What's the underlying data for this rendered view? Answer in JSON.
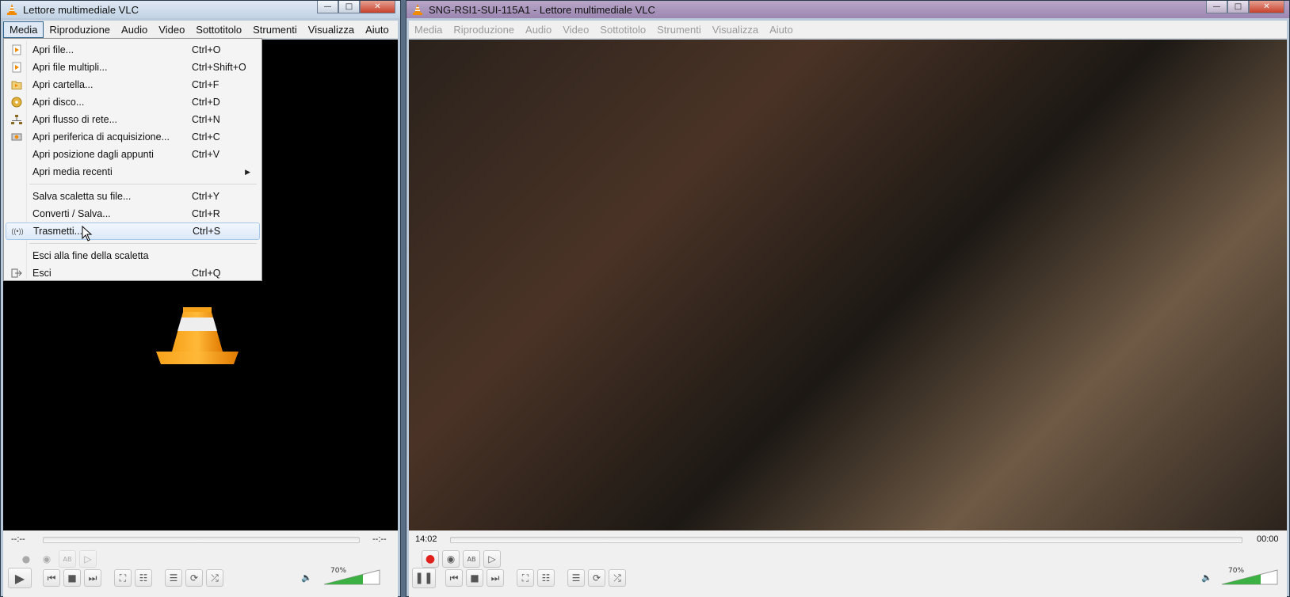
{
  "left_window": {
    "title": "Lettore multimediale VLC",
    "menus": [
      "Media",
      "Riproduzione",
      "Audio",
      "Video",
      "Sottotitolo",
      "Strumenti",
      "Visualizza",
      "Aiuto"
    ],
    "active_menu": "Media",
    "time_elapsed": "--:--",
    "time_total": "--:--",
    "volume": "70%",
    "volume_level": 0.7,
    "media_menu": {
      "group1": [
        {
          "label": "Apri file...",
          "shortcut": "Ctrl+O",
          "icon": "file-icon"
        },
        {
          "label": "Apri file multipli...",
          "shortcut": "Ctrl+Shift+O",
          "icon": "files-icon"
        },
        {
          "label": "Apri cartella...",
          "shortcut": "Ctrl+F",
          "icon": "folder-icon"
        },
        {
          "label": "Apri disco...",
          "shortcut": "Ctrl+D",
          "icon": "disc-icon"
        },
        {
          "label": "Apri flusso di rete...",
          "shortcut": "Ctrl+N",
          "icon": "network-icon"
        },
        {
          "label": "Apri periferica di acquisizione...",
          "shortcut": "Ctrl+C",
          "icon": "capture-icon"
        },
        {
          "label": "Apri posizione dagli appunti",
          "shortcut": "Ctrl+V"
        },
        {
          "label": "Apri media recenti",
          "shortcut": ""
        }
      ],
      "group2": [
        {
          "label": "Salva scaletta su file...",
          "shortcut": "Ctrl+Y"
        },
        {
          "label": "Converti / Salva...",
          "shortcut": "Ctrl+R"
        },
        {
          "label": "Trasmetti...",
          "shortcut": "Ctrl+S",
          "icon": "stream-icon"
        }
      ],
      "group3": [
        {
          "label": "Esci alla fine della scaletta",
          "shortcut": ""
        },
        {
          "label": "Esci",
          "shortcut": "Ctrl+Q",
          "icon": "exit-icon"
        }
      ]
    }
  },
  "right_window": {
    "title": "SNG-RSI1-SUI-115A1 - Lettore multimediale VLC",
    "menus": [
      "Media",
      "Riproduzione",
      "Audio",
      "Video",
      "Sottotitolo",
      "Strumenti",
      "Visualizza",
      "Aiuto"
    ],
    "time_elapsed": "14:02",
    "time_total": "00:00",
    "volume": "70%",
    "volume_level": 0.7,
    "record_active": true
  },
  "colors": {
    "vlc_orange": "#f08a00",
    "record_red": "#e0201b",
    "volume_green": "#3cb043",
    "menu_highlight_border": "#a8c8ea"
  }
}
